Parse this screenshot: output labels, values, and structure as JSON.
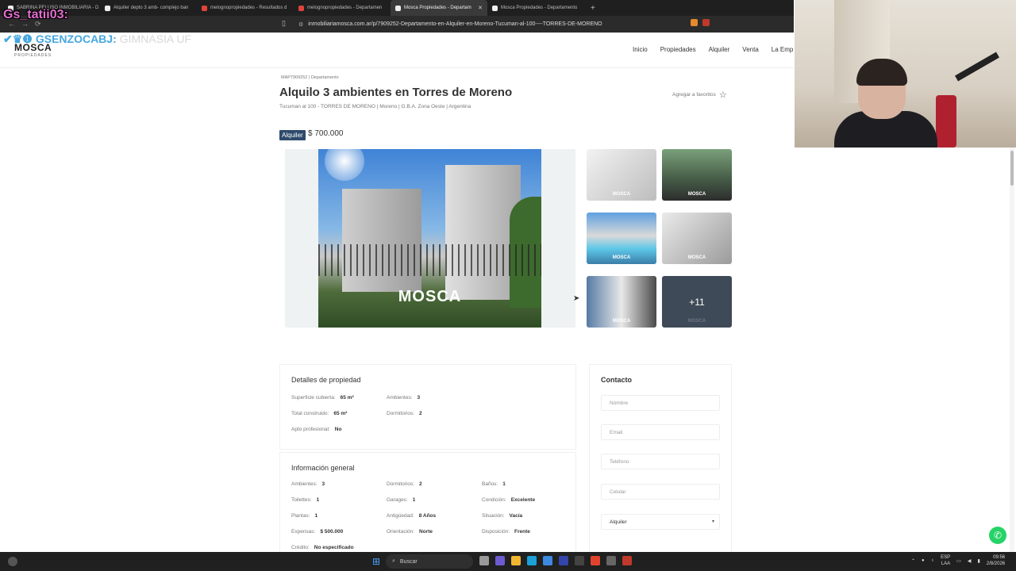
{
  "browser": {
    "tabs": [
      {
        "label": "SABRINA PELUSO INMOBILIARIA - D",
        "fav": "white",
        "active": false
      },
      {
        "label": "Alquiler depto 3 amb- complejo ban",
        "fav": "white",
        "active": false
      },
      {
        "label": "melognopropiedades - Resultados d",
        "fav": "red",
        "active": false
      },
      {
        "label": "melognopropiedades - Departamen",
        "fav": "red",
        "active": false
      },
      {
        "label": "Mosca Propiedades - Departam",
        "fav": "white",
        "active": true
      },
      {
        "label": "Mosca Propiedades - Departamento",
        "fav": "white",
        "active": false
      }
    ],
    "url": "inmobiliariamosca.com.ar/p/7909252-Departamento-en-Alquiler-en-Moreno-Tucuman-al-100----TORRES-DE-MORENO"
  },
  "overlay": {
    "username": "Gs_tatii03:",
    "club_name": "GSENZOCABJ:",
    "club_suffix": "GIMNASIA UF"
  },
  "site": {
    "logo": "MOSCA",
    "logo_sub": "PROPIEDADES",
    "nav": [
      "Inicio",
      "Propiedades",
      "Alquiler",
      "Venta",
      "La Emp"
    ]
  },
  "property": {
    "crumb": "MAP7909252 | Departamento",
    "title": "Alquilo 3 ambientes en Torres de Moreno",
    "address": "Tucuman al 100 - TORRES DE MORENO | Moreno | G.B.A. Zona Oeste | Argentina",
    "favorites_label": "Agregar a favoritos",
    "operation": "Alquiler",
    "price": "$ 700.000",
    "photo_watermark": "MOSCA",
    "more_photos": "+11"
  },
  "details": {
    "title": "Detalles de propiedad",
    "rows": [
      {
        "label": "Superficie cubierta:",
        "value": "65 m²"
      },
      {
        "label": "Ambientes:",
        "value": "3"
      },
      {
        "label": "Total construido:",
        "value": "65 m²"
      },
      {
        "label": "Dormitorios:",
        "value": "2"
      },
      {
        "label": "Apto profesional:",
        "value": "No"
      }
    ]
  },
  "general": {
    "title": "Información general",
    "rows": [
      {
        "label": "Ambientes:",
        "value": "3"
      },
      {
        "label": "Dormitorios:",
        "value": "2"
      },
      {
        "label": "Baños:",
        "value": "1"
      },
      {
        "label": "Toilettes:",
        "value": "1"
      },
      {
        "label": "Garages:",
        "value": "1"
      },
      {
        "label": "Condición:",
        "value": "Excelente"
      },
      {
        "label": "Plantas:",
        "value": "1"
      },
      {
        "label": "Antigüedad:",
        "value": "8 Años"
      },
      {
        "label": "Situación:",
        "value": "Vacía"
      },
      {
        "label": "Expensas:",
        "value": "$ 500.000"
      },
      {
        "label": "Orientación:",
        "value": "Norte"
      },
      {
        "label": "Disposición:",
        "value": "Frente"
      },
      {
        "label": "Crédito:",
        "value": "No especificado"
      }
    ]
  },
  "contact": {
    "title": "Contacto",
    "fields": [
      "Nombre",
      "Email",
      "Teléfono",
      "Celular"
    ],
    "select_value": "Alquiler"
  },
  "taskbar": {
    "search": "Buscar",
    "lang_top": "ESP",
    "lang_bottom": "LAA",
    "time": "09:56",
    "date": "2/8/2026"
  }
}
